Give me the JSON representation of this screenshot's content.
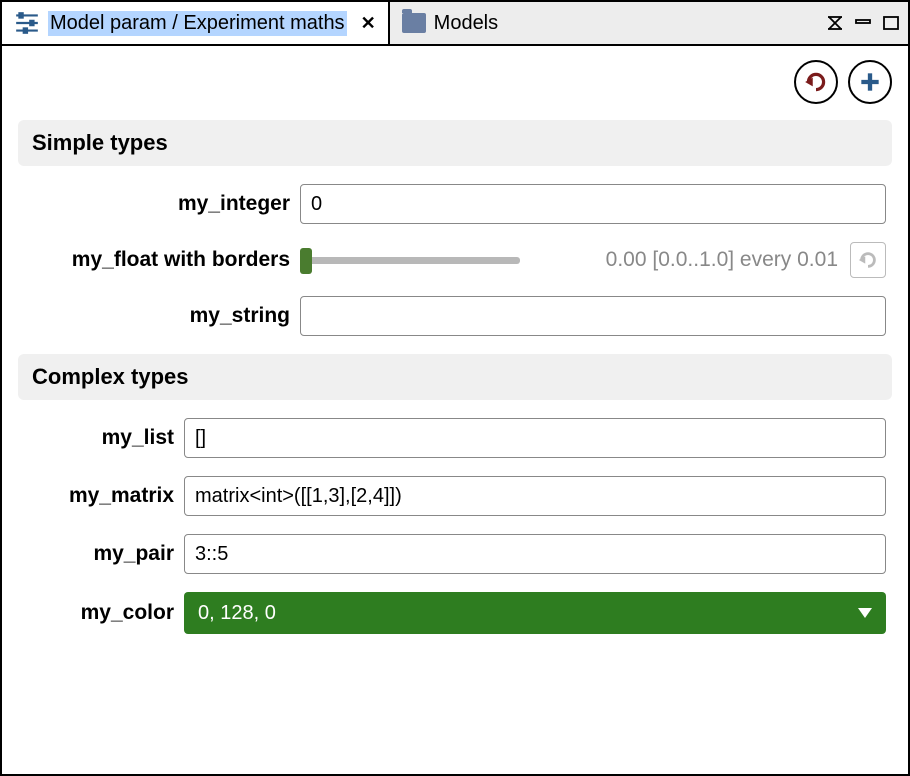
{
  "tabs": {
    "active_title": "Model param / Experiment maths",
    "inactive_title": "Models"
  },
  "sections": {
    "simple_title": "Simple types",
    "complex_title": "Complex types"
  },
  "fields": {
    "my_integer": {
      "label": "my_integer",
      "value": "0"
    },
    "my_float": {
      "label": "my_float with borders",
      "caption": "0.00 [0.0..1.0] every 0.01"
    },
    "my_string": {
      "label": "my_string",
      "value": ""
    },
    "my_list": {
      "label": "my_list",
      "value": "[]"
    },
    "my_matrix": {
      "label": "my_matrix",
      "value": "matrix<int>([[1,3],[2,4]])"
    },
    "my_pair": {
      "label": "my_pair",
      "value": "3::5"
    },
    "my_color": {
      "label": "my_color",
      "value": "0, 128, 0"
    }
  }
}
